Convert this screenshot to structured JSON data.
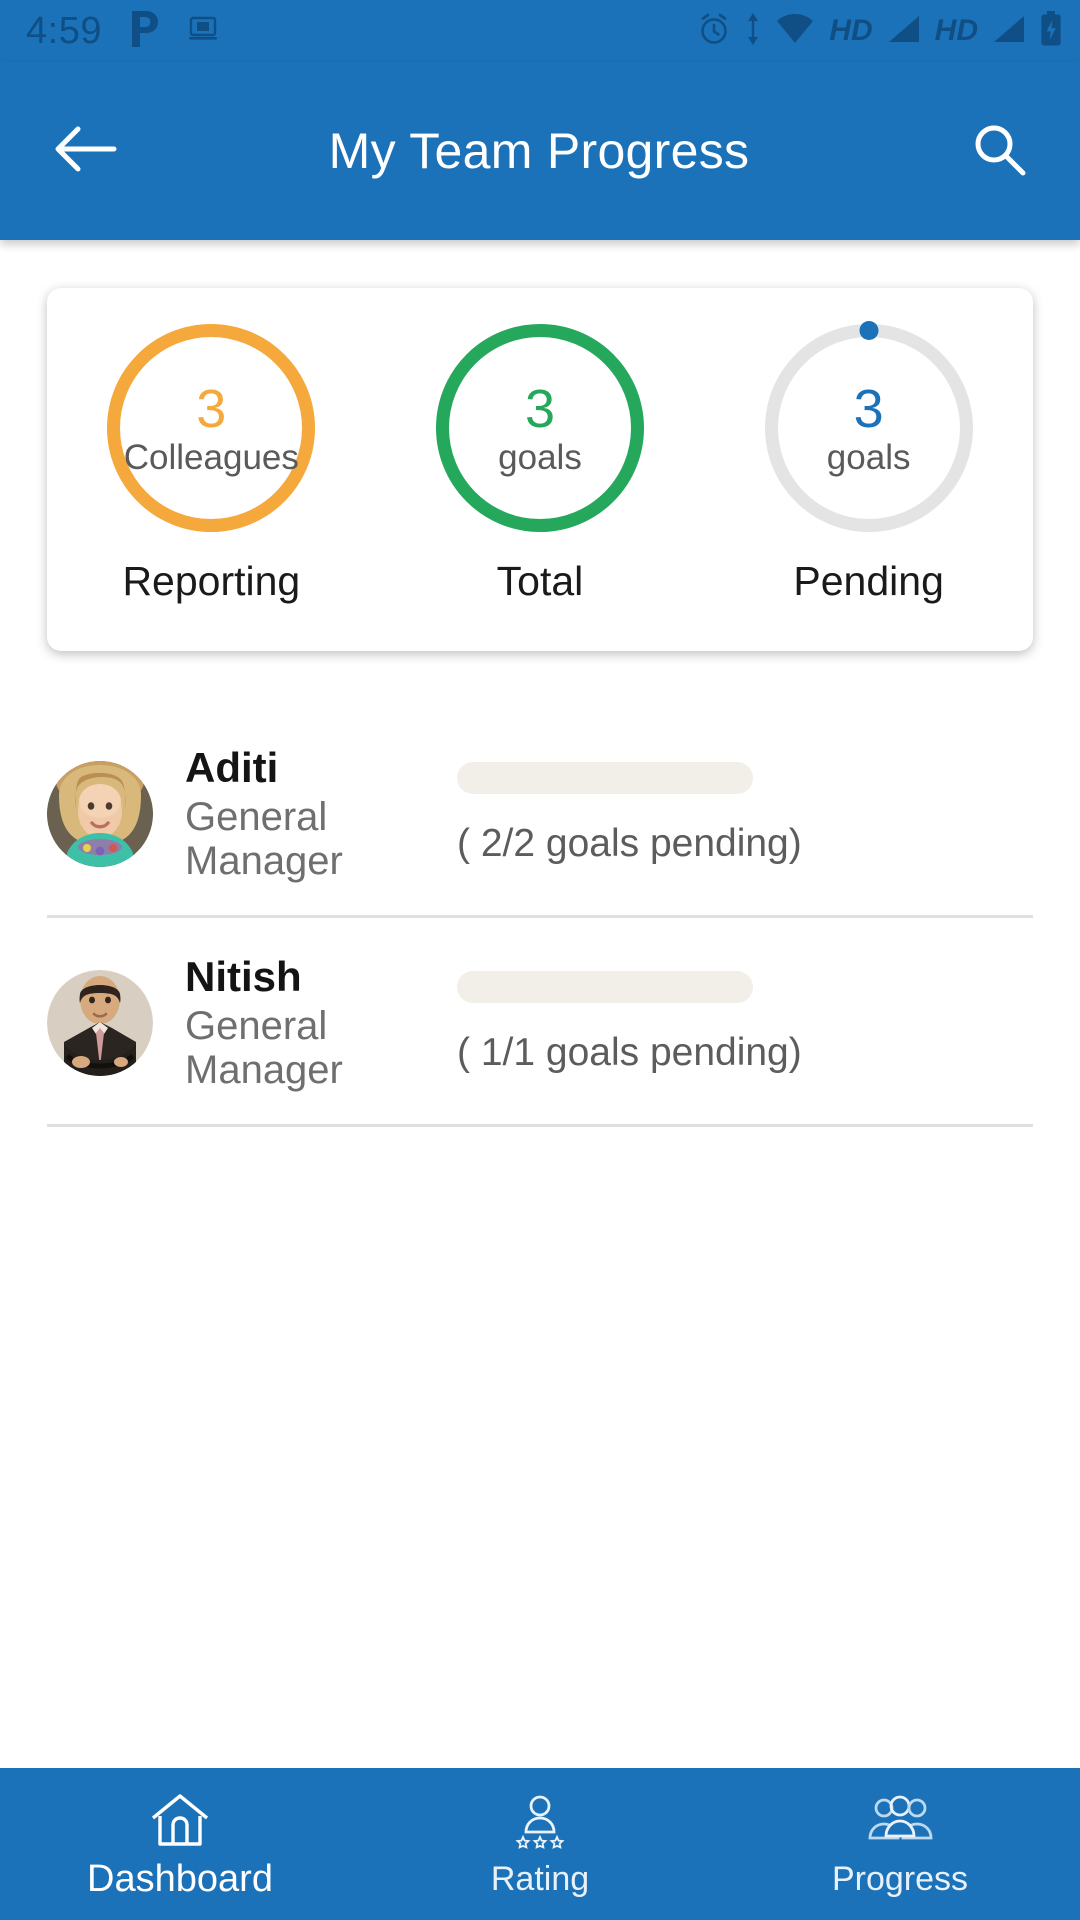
{
  "status_bar": {
    "time": "4:59",
    "left_icons": [
      "pandora-p-icon",
      "screencast-icon"
    ],
    "right_icons": [
      "alarm-icon",
      "data-transfer-icon",
      "wifi-icon",
      "hd-badge",
      "signal-icon",
      "hd-badge-2",
      "signal-icon-2",
      "battery-charging-icon"
    ],
    "hd_label": "HD",
    "hd_label_2": "HD",
    "background_color": "#1c72b8",
    "icon_color": "#0f4f85"
  },
  "app_bar": {
    "back_icon": "arrow-left-icon",
    "title": "My Team Progress",
    "search_icon": "search-icon",
    "background_color": "#1c72b8",
    "title_color": "#ffffff"
  },
  "summary_card": {
    "stats": [
      {
        "value": "3",
        "unit": "Colleagues",
        "label": "Reporting",
        "ring_color": "#f5a83c",
        "value_color": "#f5a83c",
        "has_dot": false
      },
      {
        "value": "3",
        "unit": "goals",
        "label": "Total",
        "ring_color": "#25a85b",
        "value_color": "#25a85b",
        "has_dot": false
      },
      {
        "value": "3",
        "unit": "goals",
        "label": "Pending",
        "ring_color": "#e4e4e4",
        "value_color": "#1c72b8",
        "has_dot": true,
        "dot_color": "#1c72b8"
      }
    ]
  },
  "members": [
    {
      "name": "Aditi",
      "role": "General Manager",
      "avatar": "avatar-aditi",
      "progress_percent": 0,
      "progress_caption": "( 2/2 goals pending)",
      "track_color": "#f1efe7"
    },
    {
      "name": "Nitish",
      "role": "General Manager",
      "avatar": "avatar-nitish",
      "progress_percent": 0,
      "progress_caption": "( 1/1 goals pending)",
      "track_color": "#f1efe7"
    }
  ],
  "bottom_nav": {
    "items": [
      {
        "label": "Dashboard",
        "icon": "home-icon",
        "active": true
      },
      {
        "label": "Rating",
        "icon": "person-stars-icon",
        "active": false
      },
      {
        "label": "Progress",
        "icon": "people-group-icon",
        "active": false
      }
    ],
    "background_color": "#1c72b8"
  }
}
